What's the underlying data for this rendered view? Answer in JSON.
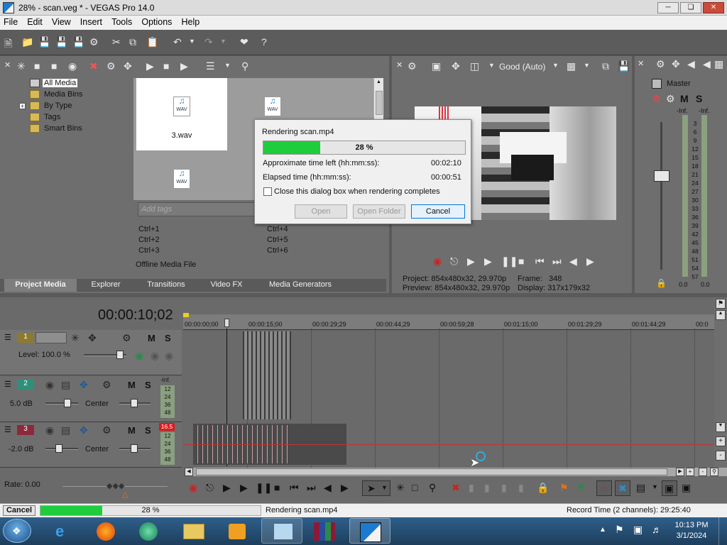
{
  "window": {
    "title": "28% - scan.veg * - VEGAS Pro 14.0"
  },
  "menu": [
    "File",
    "Edit",
    "View",
    "Insert",
    "Tools",
    "Options",
    "Help"
  ],
  "media_tree": {
    "items": [
      "All Media",
      "Media Bins",
      "By Type",
      "Tags",
      "Smart Bins"
    ],
    "expand": "+"
  },
  "media_files": [
    {
      "label": "3.wav",
      "type": "WAV"
    },
    {
      "label": "",
      "type": "WAV"
    },
    {
      "label": "",
      "type": "WAV"
    }
  ],
  "tags": {
    "placeholder": "Add tags",
    "shortcuts": [
      "Ctrl+1",
      "Ctrl+2",
      "Ctrl+3",
      "Ctrl+4",
      "Ctrl+5",
      "Ctrl+6"
    ]
  },
  "offline_label": "Offline Media File",
  "tabs": [
    "Project Media",
    "Explorer",
    "Transitions",
    "Video FX",
    "Media Generators"
  ],
  "dialog": {
    "title": "Rendering scan.mp4",
    "progress_text": "28 %",
    "progress": 0.28,
    "time_left_label": "Approximate time left (hh:mm:ss):",
    "time_left": "00:02:10",
    "elapsed_label": "Elapsed time (hh:mm:ss):",
    "elapsed": "00:00:51",
    "checkbox_label": "Close this dialog box when rendering completes",
    "buttons": [
      "Open",
      "Open Folder",
      "Cancel"
    ]
  },
  "preview": {
    "quality": "Good (Auto)",
    "project_label": "Project:",
    "project": "854x480x32, 29.970p",
    "preview_label": "Preview:",
    "preview": "854x480x32, 29.970p",
    "frame_label": "Frame:",
    "frame": "348",
    "display_label": "Display:",
    "display": "317x179x32"
  },
  "master": {
    "label": "Master",
    "m": "M",
    "s": "S",
    "inf_left": "-Inf.",
    "inf_right": "-Inf.",
    "scale": [
      "3",
      "6",
      "9",
      "12",
      "15",
      "18",
      "21",
      "24",
      "27",
      "30",
      "33",
      "36",
      "39",
      "42",
      "45",
      "48",
      "51",
      "54",
      "57"
    ],
    "bottom_left": "0.0",
    "bottom_right": "0.0"
  },
  "timeline": {
    "timecode": "00:00:10;02",
    "ruler": [
      "00:00:00;00",
      "00:00:15;00",
      "00:00:29;29",
      "00:00:44;29",
      "00:00:59;28",
      "00:01:15;00",
      "00:01:29;29",
      "00:01:44;29",
      "00:0"
    ],
    "tracks": [
      {
        "num": "1",
        "m": "M",
        "s": "S",
        "level": "Level: 100.0 %"
      },
      {
        "num": "2",
        "m": "M",
        "s": "S",
        "db": "5.0 dB",
        "pan": "Center",
        "meter_top": "-Inf.",
        "meter": [
          "12",
          "24",
          "36",
          "48"
        ]
      },
      {
        "num": "3",
        "m": "M",
        "s": "S",
        "db": "-2.0 dB",
        "pan": "Center",
        "meter_top": "16.5",
        "meter": [
          "12",
          "24",
          "36",
          "48"
        ]
      }
    ],
    "rate": "Rate: 0.00"
  },
  "status": {
    "cancel": "Cancel",
    "progress_text": "28 %",
    "progress": 0.28,
    "rendering": "Rendering scan.mp4",
    "record_time": "Record Time (2 channels): 29:25:40"
  },
  "taskbar": {
    "time": "10:13 PM",
    "date": "3/1/2024"
  },
  "colors": {
    "progress": "#1fcc3c",
    "accent": "#1c7bd1",
    "track1": "#8e7a2e",
    "track2": "#2f8f7a",
    "track3": "#8a2a3a"
  }
}
